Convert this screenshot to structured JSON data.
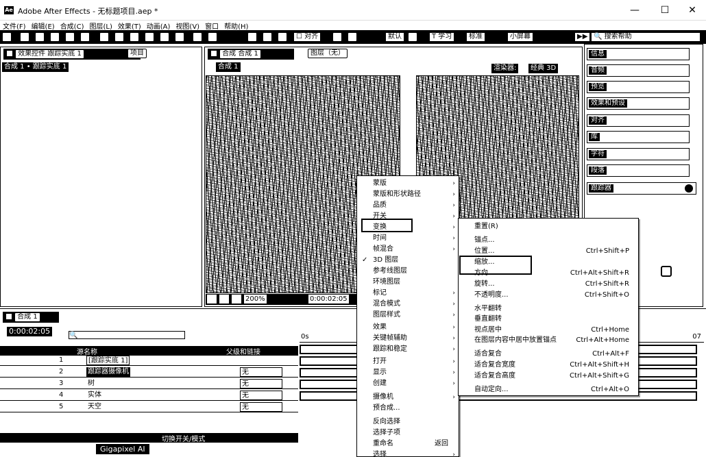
{
  "window": {
    "title": "Adobe After Effects - 无标题项目.aep *",
    "app_icon": "Ae"
  },
  "menu": [
    "文件(F)",
    "编辑(E)",
    "合成(C)",
    "图层(L)",
    "效果(T)",
    "动画(A)",
    "视图(V)",
    "窗口",
    "帮助(H)"
  ],
  "toolbar": {
    "align": "对齐",
    "default": "默认",
    "standard": "标准",
    "small_screen": "小屏幕",
    "search_help": "搜索帮助"
  },
  "effects_panel": {
    "tab": "效果控件 跟踪实底 1",
    "project_tab": "项目",
    "breadcrumb": "合成 1 • 跟踪实底 1"
  },
  "comp_panel": {
    "tab": "合成 合成 1",
    "layer_tab": "图层（无）",
    "comp_chip": "合成 1",
    "renderer": "渲染器:",
    "renderer_value": "经典 3D",
    "zoom": "200%",
    "timecode": "0:00:02:05"
  },
  "right_panels": [
    "信息",
    "音频",
    "预览",
    "效果和预设",
    "对齐",
    "库",
    "字符",
    "段落",
    "跟踪器"
  ],
  "timeline": {
    "tab": "合成 1",
    "timecode": "0:00:02:05",
    "col_source": "源名称",
    "col_parent": "父级和链接",
    "layers": [
      {
        "num": "1",
        "name": "[跟踪实底 1]",
        "parent": ""
      },
      {
        "num": "2",
        "name": "跟踪器摄像机",
        "parent": "无"
      },
      {
        "num": "3",
        "name": "树",
        "parent": "无"
      },
      {
        "num": "4",
        "name": "实体",
        "parent": "无"
      },
      {
        "num": "5",
        "name": "天空",
        "parent": "无"
      }
    ],
    "footer": "切换开关/模式",
    "ruler_start": "0s",
    "ruler_end": "07"
  },
  "taskbar_label": "Gigapixel AI",
  "context_menu": {
    "items": [
      {
        "label": "蒙版",
        "arrow": true
      },
      {
        "label": "蒙版和形状路径",
        "arrow": true
      },
      {
        "label": "品质",
        "arrow": true
      },
      {
        "label": "开关",
        "arrow": true
      },
      {
        "label": "变换",
        "arrow": true
      },
      {
        "label": "时间",
        "arrow": true
      },
      {
        "label": "帧混合",
        "arrow": true
      },
      {
        "label": "3D 图层",
        "arrow": false,
        "checked": true
      },
      {
        "label": "参考线图层",
        "arrow": false
      },
      {
        "label": "环境图层",
        "arrow": false
      },
      {
        "label": "标记",
        "arrow": true
      },
      {
        "label": "混合模式",
        "arrow": true
      },
      {
        "label": "图层样式",
        "arrow": true
      },
      {
        "label": "效果",
        "arrow": true
      },
      {
        "label": "关键帧辅助",
        "arrow": true
      },
      {
        "label": "跟踪和稳定",
        "arrow": true
      },
      {
        "label": "打开",
        "arrow": true
      },
      {
        "label": "显示",
        "arrow": true
      },
      {
        "label": "创建",
        "arrow": true
      },
      {
        "label": "摄像机",
        "arrow": true
      },
      {
        "label": "预合成...",
        "arrow": false
      },
      {
        "label": "反向选择",
        "arrow": false
      },
      {
        "label": "选择子项",
        "arrow": false
      },
      {
        "label": "重命名",
        "arrow": false,
        "shortcut": "返回"
      },
      {
        "label": "选择",
        "arrow": true
      }
    ]
  },
  "submenu": {
    "items": [
      {
        "label": "重置(R)",
        "shortcut": ""
      },
      {
        "label": "锚点...",
        "shortcut": ""
      },
      {
        "label": "位置...",
        "shortcut": "Ctrl+Shift+P"
      },
      {
        "label": "缩放...",
        "shortcut": ""
      },
      {
        "label": "方向...",
        "shortcut": "Ctrl+Alt+Shift+R"
      },
      {
        "label": "旋转...",
        "shortcut": "Ctrl+Shift+R"
      },
      {
        "label": "不透明度...",
        "shortcut": "Ctrl+Shift+O"
      },
      {
        "label": "水平翻转",
        "shortcut": ""
      },
      {
        "label": "垂直翻转",
        "shortcut": ""
      },
      {
        "label": "视点居中",
        "shortcut": "Ctrl+Home"
      },
      {
        "label": "在图层内容中居中放置锚点",
        "shortcut": "Ctrl+Alt+Home"
      },
      {
        "label": "适合复合",
        "shortcut": "Ctrl+Alt+F"
      },
      {
        "label": "适合复合宽度",
        "shortcut": "Ctrl+Alt+Shift+H"
      },
      {
        "label": "适合复合高度",
        "shortcut": "Ctrl+Alt+Shift+G"
      },
      {
        "label": "自动定向...",
        "shortcut": "Ctrl+Alt+O"
      }
    ]
  }
}
